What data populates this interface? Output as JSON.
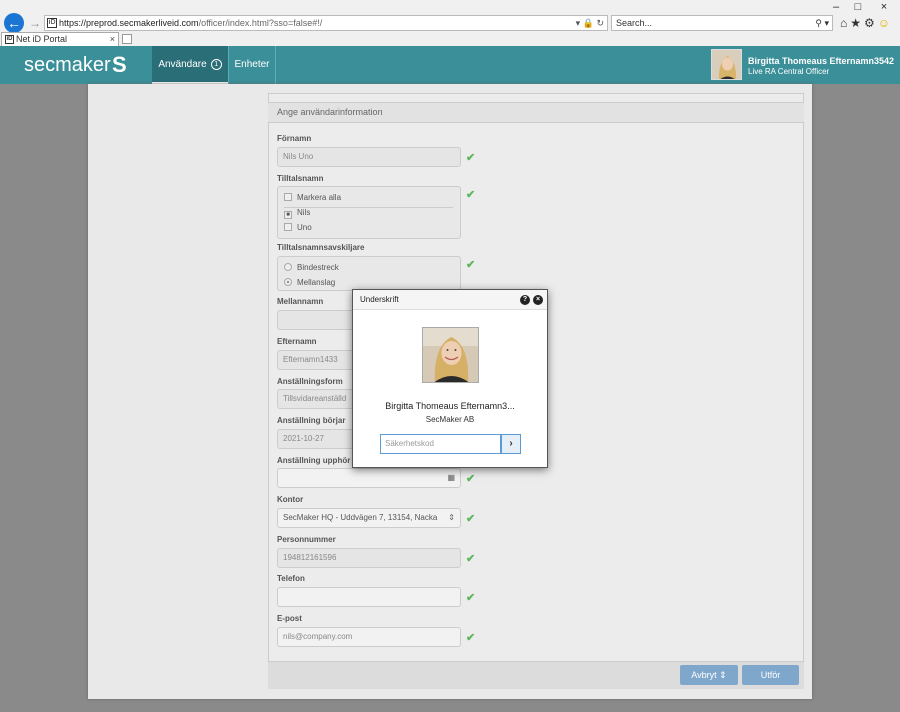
{
  "browser": {
    "url": "https://preprod.secmakerliveid.com/officer/index.html?sso=false#!/",
    "url_host": "https://preprod.secmakerliveid.com",
    "url_path": "/officer/index.html?sso=false#!/",
    "favicon_text": "iD",
    "search_placeholder": "Search...",
    "tab_title": "Net iD Portal",
    "tab_close": "×",
    "window_controls": {
      "minimize": "–",
      "maximize": "□",
      "close": "×"
    }
  },
  "app": {
    "logo_text": "secmaker",
    "logo_mark": "S",
    "nav": [
      {
        "label": "Användare",
        "badge": "1"
      },
      {
        "label": "Enheter"
      }
    ],
    "user": {
      "name": "Birgitta Thomeaus Efternamn3542",
      "role": "Live RA Central Officer"
    }
  },
  "form": {
    "section_title": "Ange användarinformation",
    "fornamn": {
      "label": "Förnamn",
      "value": "Nils Uno"
    },
    "tilltalsnamn": {
      "label": "Tilltalsnamn",
      "options": [
        "Markera alla",
        "Nils",
        "Uno"
      ]
    },
    "avskiljare": {
      "label": "Tilltalsnamnsavskiljare",
      "options": [
        "Bindestreck",
        "Mellanslag"
      ]
    },
    "mellannamn": {
      "label": "Mellannamn",
      "value": ""
    },
    "efternamn": {
      "label": "Efternamn",
      "value": "Efternamn1433"
    },
    "anstallningsform": {
      "label": "Anställningsform",
      "value": "Tillsvidareanställd"
    },
    "anstallning_borjar": {
      "label": "Anställning börjar",
      "value": "2021-10-27"
    },
    "anstallning_upphor": {
      "label": "Anställning upphör",
      "value": ""
    },
    "kontor": {
      "label": "Kontor",
      "value": "SecMaker HQ - Uddvägen 7, 13154, Nacka"
    },
    "personnummer": {
      "label": "Personnummer",
      "value": "194812161596"
    },
    "telefon": {
      "label": "Telefon",
      "value": ""
    },
    "epost": {
      "label": "E-post",
      "value": "nils@company.com"
    },
    "cancel_label": "Avbryt",
    "submit_label": "Utför"
  },
  "modal": {
    "title": "Underskrift",
    "help_glyph": "?",
    "close_glyph": "×",
    "name": "Birgitta Thomeaus Efternamn3...",
    "org": "SecMaker AB",
    "code_placeholder": "Säkerhetskod",
    "go_glyph": "›"
  },
  "colors": {
    "header": "#3a8f99",
    "active_tab": "#2a6e77",
    "check": "#5cb85c",
    "button": "#7fa7cc"
  }
}
